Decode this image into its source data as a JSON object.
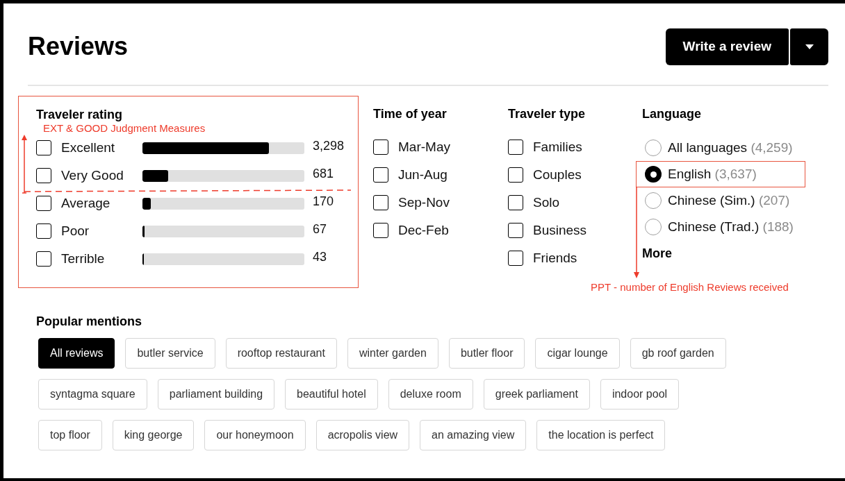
{
  "title": "Reviews",
  "write_button": {
    "label": "Write a review"
  },
  "traveler_rating": {
    "heading": "Traveler rating",
    "annotation": "EXT & GOOD Judgment Measures",
    "rows": [
      {
        "label": "Excellent",
        "checked": false,
        "level": 0.78,
        "count": "3,298"
      },
      {
        "label": "Very Good",
        "checked": false,
        "level": 0.16,
        "count": "681"
      },
      {
        "label": "Average",
        "checked": false,
        "level": 0.05,
        "count": "170"
      },
      {
        "label": "Poor",
        "checked": false,
        "level": 0.015,
        "count": "67"
      },
      {
        "label": "Terrible",
        "checked": false,
        "level": 0.01,
        "count": "43"
      }
    ]
  },
  "time_of_year": {
    "heading": "Time of year",
    "options": [
      {
        "label": "Mar-May",
        "checked": false
      },
      {
        "label": "Jun-Aug",
        "checked": false
      },
      {
        "label": "Sep-Nov",
        "checked": false
      },
      {
        "label": "Dec-Feb",
        "checked": false
      }
    ]
  },
  "traveler_type": {
    "heading": "Traveler type",
    "options": [
      {
        "label": "Families",
        "checked": false
      },
      {
        "label": "Couples",
        "checked": false
      },
      {
        "label": "Solo",
        "checked": false
      },
      {
        "label": "Business",
        "checked": false
      },
      {
        "label": "Friends",
        "checked": false
      }
    ]
  },
  "language": {
    "heading": "Language",
    "options": [
      {
        "label": "All languages",
        "count": "(4,259)",
        "selected": false,
        "annotated": false
      },
      {
        "label": "English",
        "count": "(3,637)",
        "selected": true,
        "annotated": true
      },
      {
        "label": "Chinese (Sim.)",
        "count": "(207)",
        "selected": false,
        "annotated": false
      },
      {
        "label": "Chinese (Trad.)",
        "count": "(188)",
        "selected": false,
        "annotated": false
      }
    ],
    "more": "More",
    "annotation": "PPT - number of English Reviews received"
  },
  "popular_mentions": {
    "heading": "Popular mentions",
    "rows": [
      [
        {
          "label": "All reviews",
          "selected": true
        },
        {
          "label": "butler service",
          "selected": false
        },
        {
          "label": "rooftop restaurant",
          "selected": false
        },
        {
          "label": "winter garden",
          "selected": false
        },
        {
          "label": "butler floor",
          "selected": false
        },
        {
          "label": "cigar lounge",
          "selected": false
        },
        {
          "label": "gb roof garden",
          "selected": false
        }
      ],
      [
        {
          "label": "syntagma square",
          "selected": false
        },
        {
          "label": "parliament building",
          "selected": false
        },
        {
          "label": "beautiful hotel",
          "selected": false
        },
        {
          "label": "deluxe room",
          "selected": false
        },
        {
          "label": "greek parliament",
          "selected": false
        },
        {
          "label": "indoor pool",
          "selected": false
        }
      ],
      [
        {
          "label": "top floor",
          "selected": false
        },
        {
          "label": "king george",
          "selected": false
        },
        {
          "label": "our honeymoon",
          "selected": false
        },
        {
          "label": "acropolis view",
          "selected": false
        },
        {
          "label": "an amazing view",
          "selected": false
        },
        {
          "label": "the location is perfect",
          "selected": false
        }
      ]
    ]
  }
}
